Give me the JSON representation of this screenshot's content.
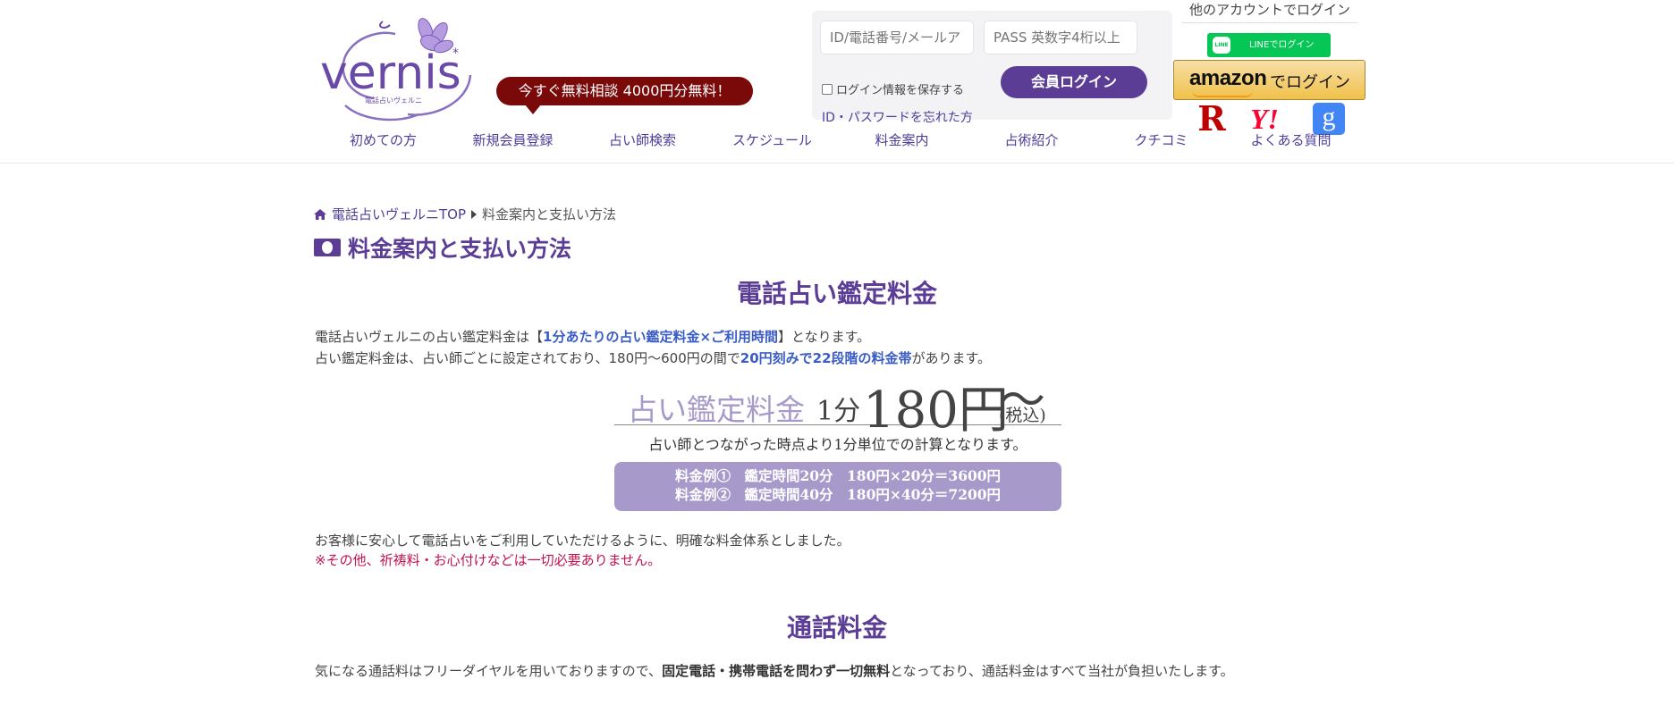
{
  "header": {
    "logo_text": "vernis",
    "logo_sub": "電話占いヴェルニ",
    "promo": "今すぐ無料相談 4000円分無料！",
    "login": {
      "id_placeholder": "ID/電話番号/メールアドレス",
      "pass_placeholder": "PASS 英数字4桁以上",
      "save_label": "ログイン情報を保存する",
      "forgot": "ID・パスワードを忘れた方",
      "member_button": "会員ログイン"
    },
    "other_login": {
      "title": "他のアカウントでログイン",
      "line_label": "LINEでログイン",
      "line_logo": "LINE",
      "amazon_logo": "amazon",
      "amazon_label": "でログイン",
      "rakuten": "R",
      "yahoo": "Y!",
      "google": "g"
    }
  },
  "nav": {
    "items": [
      {
        "label": "初めての方"
      },
      {
        "label": "新規会員登録"
      },
      {
        "label": "占い師検索"
      },
      {
        "label": "スケジュール"
      },
      {
        "label": "料金案内"
      },
      {
        "label": "占術紹介"
      },
      {
        "label": "クチコミ"
      },
      {
        "label": "よくある質問"
      }
    ]
  },
  "breadcrumb": {
    "home": "電話占いヴェルニTOP",
    "current": "料金案内と支払い方法"
  },
  "page_title": "料金案内と支払い方法",
  "section1": {
    "heading": "電話占い鑑定料金",
    "line1_a": "電話占いヴェルニの占い鑑定料金は【",
    "line1_hl": "1分あたりの占い鑑定料金×ご利用時間",
    "line1_b": "】となります。",
    "line2_a": "占い鑑定料金は、占い師ごとに設定されており、180円〜600円の間で",
    "line2_hl": "20円刻みで22段階の料金帯",
    "line2_b": "があります。",
    "price_label": "占い鑑定料金",
    "price_per": "1分",
    "price_value": "180円",
    "price_tilde": "〜",
    "price_tax": "(税込)",
    "calc_note": "占い師とつながった時点より1分単位での計算となります。",
    "example1": "料金例①　鑑定時間20分　180円×20分＝3600円",
    "example2": "料金例②　鑑定時間40分　180円×40分＝7200円",
    "closing": "お客様に安心して電話占いをご利用していただけるように、明確な料金体系としました。",
    "note": "※その他、祈祷料・お心付けなどは一切必要ありません。"
  },
  "section2": {
    "heading": "通話料金",
    "line_a": "気になる通話料はフリーダイヤルを用いておりますので、",
    "line_bold": "固定電話・携帯電話を問わず一切無料",
    "line_b": "となっており、通話料金はすべて当社が負担いたします。"
  }
}
